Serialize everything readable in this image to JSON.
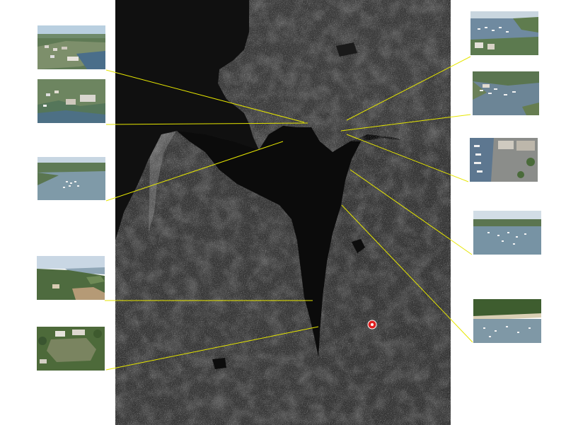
{
  "map": {
    "type": "satellite-photo",
    "tone": "grayscale",
    "marker": {
      "icon": "map-pin-icon",
      "color": "#e02020"
    },
    "callout_line_color": "#e6e600"
  },
  "photos": [
    {
      "subject": "aerial-waterfront-neighborhood"
    },
    {
      "subject": "aerial-harbor-buildings"
    },
    {
      "subject": "aerial-marina-cove"
    },
    {
      "subject": "aerial-bluff-overlook"
    },
    {
      "subject": "aerial-campus-field"
    },
    {
      "subject": "aerial-marina-docks"
    },
    {
      "subject": "aerial-harbor-boats"
    },
    {
      "subject": "aerial-boatyard"
    },
    {
      "subject": "aerial-moored-boats"
    },
    {
      "subject": "aerial-beach-shoreline"
    }
  ]
}
